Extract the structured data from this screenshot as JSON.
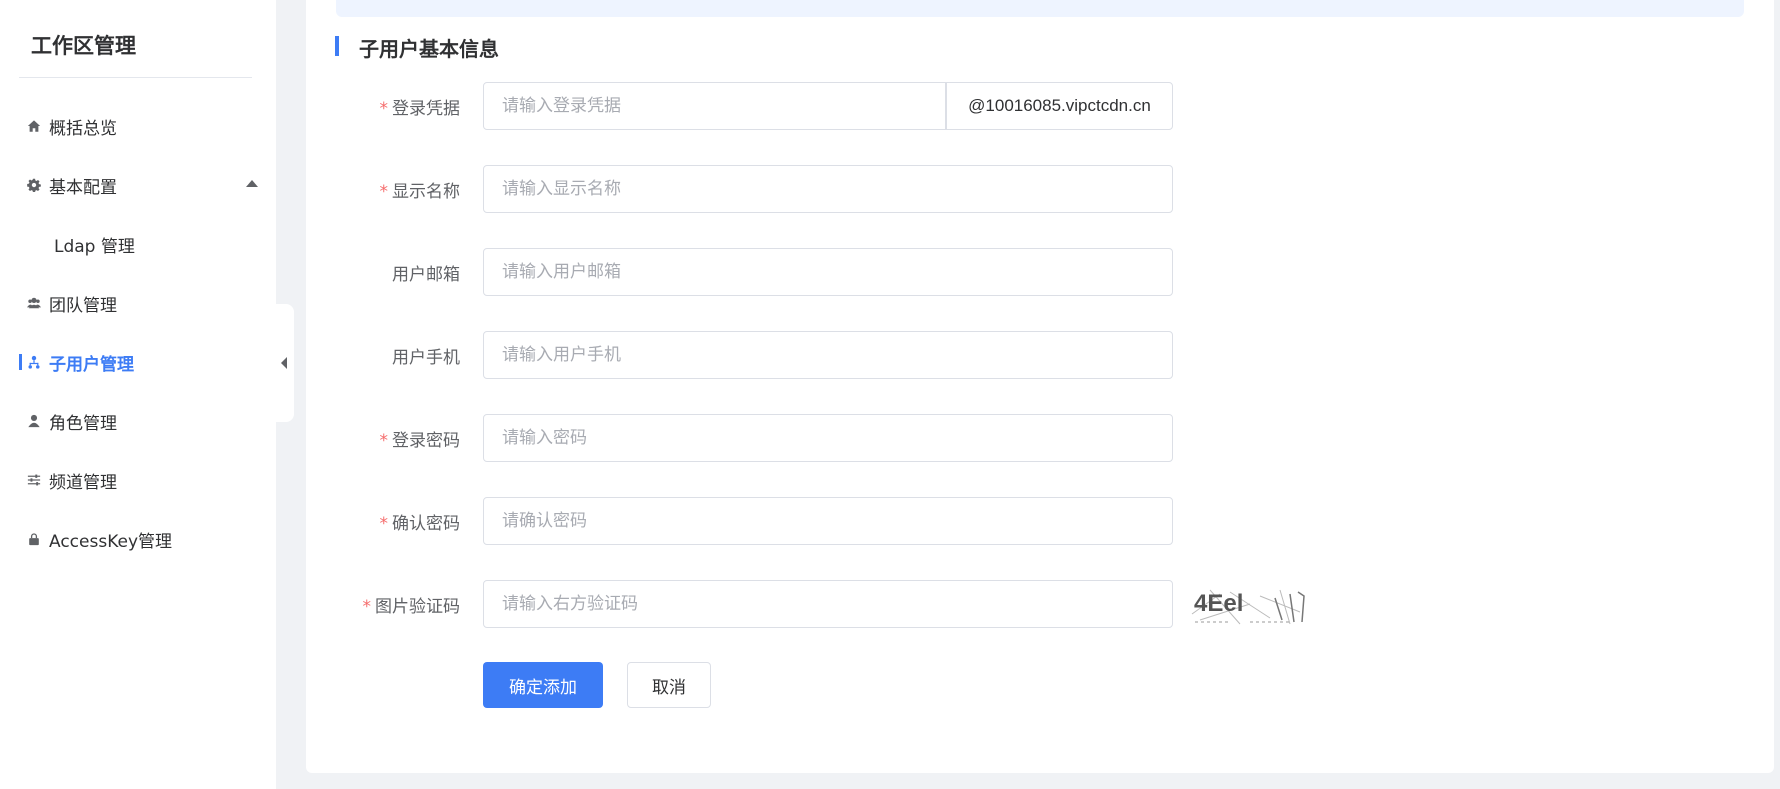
{
  "sidebar": {
    "title": "工作区管理",
    "items": [
      {
        "label": "概括总览",
        "icon": "home-icon"
      },
      {
        "label": "基本配置",
        "icon": "gear-icon",
        "expanded": true
      },
      {
        "label": "Ldap 管理",
        "icon": ""
      },
      {
        "label": "团队管理",
        "icon": "team-icon"
      },
      {
        "label": "子用户管理",
        "icon": "sub-user-icon",
        "active": true
      },
      {
        "label": "角色管理",
        "icon": "user-icon"
      },
      {
        "label": "频道管理",
        "icon": "sliders-icon"
      },
      {
        "label": "AccessKey管理",
        "icon": "lock-icon"
      }
    ]
  },
  "form": {
    "section_title": "子用户基本信息",
    "fields": {
      "login": {
        "label": "登录凭据",
        "required": true,
        "placeholder": "请输入登录凭据",
        "suffix": "@10016085.vipctcdn.cn"
      },
      "display_name": {
        "label": "显示名称",
        "required": true,
        "placeholder": "请输入显示名称"
      },
      "email": {
        "label": "用户邮箱",
        "required": false,
        "placeholder": "请输入用户邮箱"
      },
      "phone": {
        "label": "用户手机",
        "required": false,
        "placeholder": "请输入用户手机"
      },
      "password": {
        "label": "登录密码",
        "required": true,
        "placeholder": "请输入密码"
      },
      "confirm_password": {
        "label": "确认密码",
        "required": true,
        "placeholder": "请确认密码"
      },
      "captcha": {
        "label": "图片验证码",
        "required": true,
        "placeholder": "请输入右方验证码",
        "image_text": "4Eel"
      }
    },
    "required_mark": "*",
    "submit_label": "确定添加",
    "cancel_label": "取消"
  },
  "colors": {
    "accent": "#3d7cf5",
    "required": "#f56c6c",
    "banner": "#eef4ff"
  }
}
